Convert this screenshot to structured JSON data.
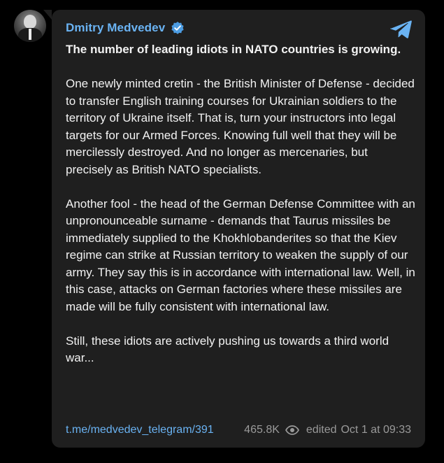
{
  "channel": {
    "name": "Dmitry Medvedev",
    "verified_icon": "verified-badge-icon",
    "app_icon": "telegram-plane-icon",
    "accent_color": "#6ab3f3"
  },
  "message": {
    "paragraph_1": "The number of leading idiots in NATO countries is growing.",
    "paragraph_2": "One newly minted cretin - the British Minister of Defense - decided to transfer English training courses for Ukrainian soldiers to the territory of Ukraine itself. That is, turn your instructors into legal targets for our Armed Forces. Knowing full well that they will be mercilessly destroyed. And no longer as mercenaries, but precisely as British NATO specialists.",
    "paragraph_3": "Another fool - the head of the German Defense Committee with an unpronounceable surname - demands that Taurus missiles be immediately supplied to the Khokhlobanderites so that the Kiev regime can strike at Russian territory to weaken the supply of our army. They say this is in accordance with international law. Well, in this case, attacks on German factories where these missiles are made will be fully consistent with international law.",
    "paragraph_4": "Still, these idiots are actively pushing us towards a third world war..."
  },
  "footer": {
    "link": "t.me/medvedev_telegram/391",
    "views": "465.8K",
    "views_icon": "eye-icon",
    "edited": "edited",
    "date": "Oct 1 at 09:33"
  }
}
